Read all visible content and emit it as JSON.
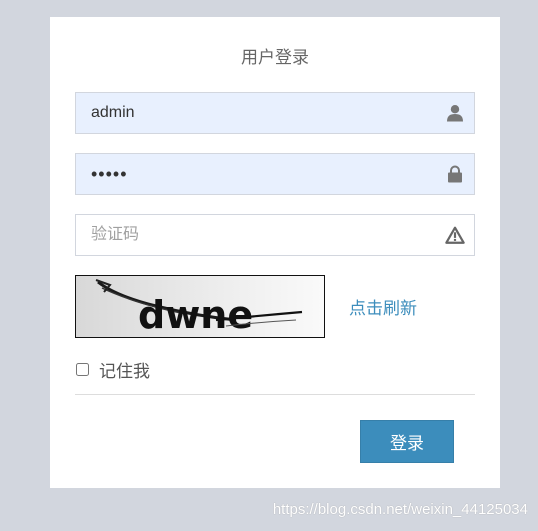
{
  "login": {
    "title": "用户登录",
    "username": {
      "value": "admin"
    },
    "password": {
      "value": "admin"
    },
    "captcha": {
      "placeholder": "验证码",
      "value": "",
      "image_text": "dwne"
    },
    "refresh_label": "点击刷新",
    "remember_label": "记住我",
    "remember_checked": false,
    "submit_label": "登录"
  },
  "icons": {
    "username": "user-icon",
    "password": "lock-icon",
    "captcha": "warning-icon"
  },
  "colors": {
    "page_background": "#d2d6de",
    "accent": "#3c8dbc",
    "autofill": "#e8f0fe"
  },
  "watermark": "https://blog.csdn.net/weixin_44125034"
}
